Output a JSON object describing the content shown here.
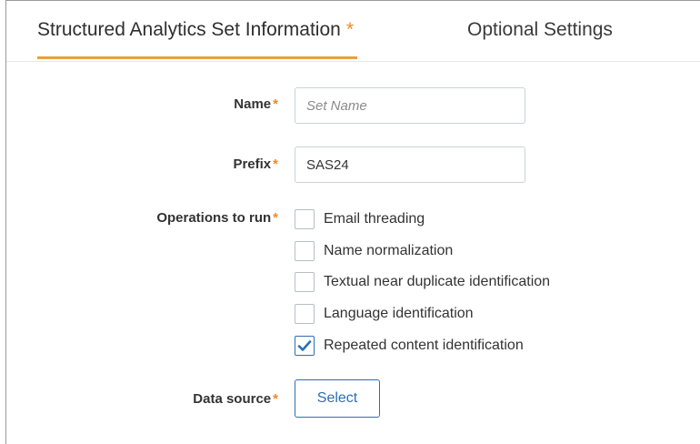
{
  "tabs": {
    "active": {
      "label": "Structured Analytics Set Information",
      "required_marker": "*"
    },
    "optional": {
      "label": "Optional Settings"
    }
  },
  "form": {
    "name": {
      "label": "Name",
      "required_marker": "*",
      "value": "",
      "placeholder": "Set Name"
    },
    "prefix": {
      "label": "Prefix",
      "required_marker": "*",
      "value": "SAS24"
    },
    "operations": {
      "label": "Operations to run",
      "required_marker": "*",
      "items": [
        {
          "label": "Email threading",
          "checked": false
        },
        {
          "label": "Name normalization",
          "checked": false
        },
        {
          "label": "Textual near duplicate identification",
          "checked": false
        },
        {
          "label": "Language identification",
          "checked": false
        },
        {
          "label": "Repeated content identification",
          "checked": true
        }
      ]
    },
    "data_source": {
      "label": "Data source",
      "required_marker": "*",
      "button_label": "Select"
    }
  },
  "colors": {
    "accent_orange": "#e8a13c",
    "required_star": "#f08a24",
    "primary_blue": "#2b6fb6"
  },
  "icons": {
    "checkmark": "checkmark-icon"
  }
}
